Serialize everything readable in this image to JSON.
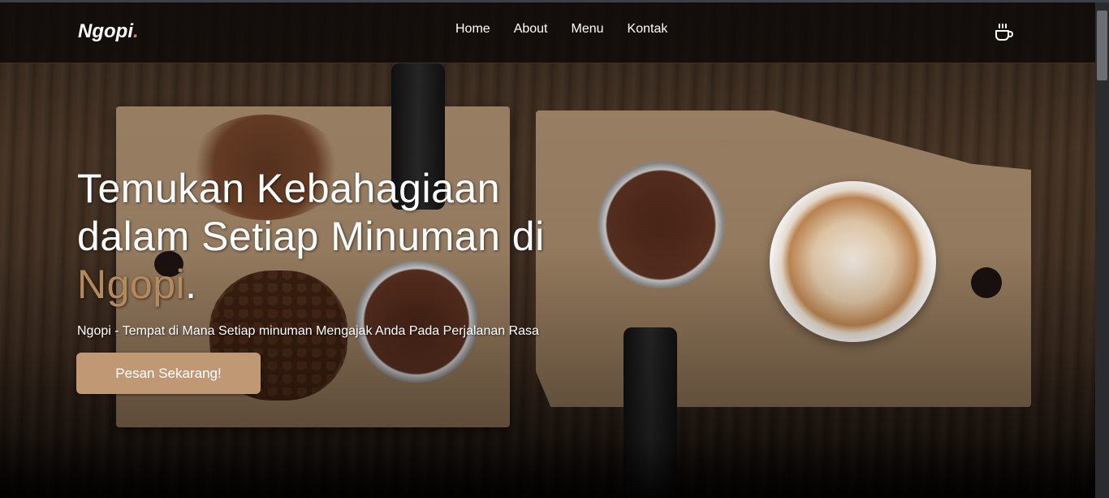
{
  "brand": {
    "name": "Ngopi",
    "dot": "."
  },
  "nav": {
    "items": [
      {
        "label": "Home"
      },
      {
        "label": "About"
      },
      {
        "label": "Menu"
      },
      {
        "label": "Kontak"
      }
    ],
    "cart_icon": "coffee-cup-icon"
  },
  "hero": {
    "heading_line1": "Temukan Kebahagiaan",
    "heading_line2": "dalam Setiap Minuman di",
    "heading_brand": "Ngopi",
    "heading_dot": ".",
    "tagline": "Ngopi - Tempat di Mana Setiap minuman Mengajak Anda Pada Perjalanan Rasa",
    "cta_label": "Pesan Sekarang!"
  },
  "colors": {
    "accent": "#b6895b",
    "button": "#c09874",
    "navbar": "#0e0a08"
  }
}
